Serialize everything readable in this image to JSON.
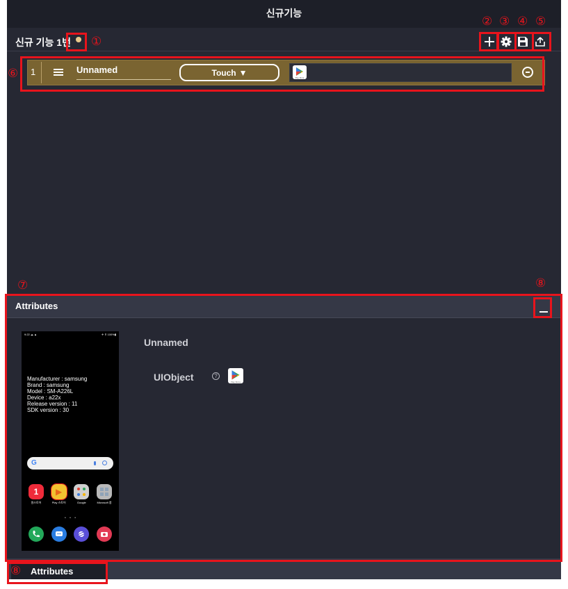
{
  "window": {
    "title": "신규기능"
  },
  "feature": {
    "title": "신규 기능 1번"
  },
  "toolbar": {
    "add": "add-icon",
    "settings": "gear-icon",
    "save": "floppy-icon",
    "export": "upload-icon"
  },
  "steps": [
    {
      "index": "1",
      "name": "Unnamed",
      "action": "Touch",
      "action_arrow": "▼",
      "target_app_label": "Play Store"
    }
  ],
  "attributes": {
    "title": "Attributes",
    "object_name": "Unnamed",
    "uiobject_label": "UIObject",
    "help_glyph": "?",
    "uiobject_app_label": "Play Store"
  },
  "device": {
    "status_left": "9:22 ☁ ▲",
    "status_right": "✈ ⚲ 100%▮",
    "info": [
      "Manufacturer : samsung",
      "Brand : samsung",
      "Model : SM-A226L",
      "Device : a22x",
      "Release version : 11",
      "SDK version : 30"
    ],
    "search_letter": "G",
    "apps_row1": [
      {
        "label": "원스토어",
        "glyph": "1"
      },
      {
        "label": "Play 스토어",
        "glyph": "▶"
      },
      {
        "label": "Google",
        "glyph": ""
      },
      {
        "label": "Microsoft 앱",
        "glyph": ""
      }
    ],
    "page_dots": "• • •"
  },
  "bottom_tab": {
    "label": "Attributes"
  },
  "annotations": [
    "①",
    "②",
    "③",
    "④",
    "⑤",
    "⑥",
    "⑦",
    "⑧",
    "⑧"
  ],
  "colors": {
    "background": "#262833",
    "step_row": "#7a6431",
    "highlight": "#e8141c",
    "dot": "#e9c98b"
  }
}
